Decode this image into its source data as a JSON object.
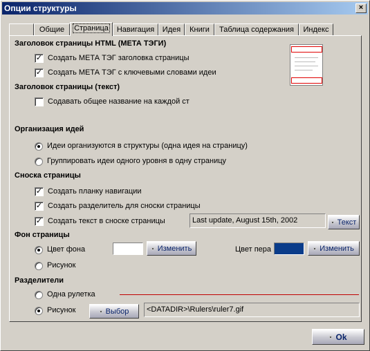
{
  "window": {
    "title": "Опции структуры",
    "close_label": "×"
  },
  "tabs": [
    {
      "label": ""
    },
    {
      "label": "Общие"
    },
    {
      "label": "Страница"
    },
    {
      "label": "Навигация"
    },
    {
      "label": "Идея"
    },
    {
      "label": "Книги"
    },
    {
      "label": "Таблица содержания"
    },
    {
      "label": "Индекс"
    }
  ],
  "sections": {
    "html_title": "Заголовок страницы HTML (МЕТА ТЭГИ)",
    "page_title": "Заголовок страницы (текст)",
    "idea_org": "Организация идей",
    "footnote": "Сноска страницы",
    "background": "Фон страницы",
    "dividers": "Разделители"
  },
  "meta": {
    "create_title_tag": {
      "label": "Создать МЕТА ТЭГ заголовка страницы",
      "checked": true
    },
    "create_keywords_tag": {
      "label": "Создать МЕТА ТЭГ с ключевыми словами идеи",
      "checked": true
    }
  },
  "page_title": {
    "common_name": {
      "label": "Содавать общее название на каждой ст",
      "checked": false
    }
  },
  "idea_org": {
    "one_per_page": {
      "label": "Идеи организуются в структуры (одна идея на страницу)",
      "selected": true
    },
    "group_same_level": {
      "label": "Группировать идеи одного уровня в одну страницу",
      "selected": false
    }
  },
  "footnote": {
    "nav_bar": {
      "label": "Создать планку навигации",
      "checked": true
    },
    "separator": {
      "label": "Создать разделитель для сноски страницы",
      "checked": true
    },
    "text": {
      "label": "Создать текст в сноске страницы",
      "checked": true,
      "value": "Last update, August 15th, 2002"
    },
    "text_button": "Текст"
  },
  "background": {
    "color_option": {
      "label": "Цвет фона",
      "selected": true,
      "swatch_color": "#ffffff"
    },
    "change_button": "Изменить",
    "image_option": {
      "label": "Рисунок",
      "selected": false
    },
    "pen_color_label": "Цвет пера",
    "pen_color": "#0a3c8a",
    "pen_change_button": "Изменить"
  },
  "dividers": {
    "single_ruler": {
      "label": "Одна рулетка",
      "selected": false,
      "line_color": "#c00000"
    },
    "image": {
      "label": "Рисунок",
      "selected": true
    },
    "choose_button": "Выбор",
    "path": "<DATADIR>\\Rulers\\ruler7.gif"
  },
  "footer": {
    "ok_button": "Ok"
  },
  "colors": {
    "title_gradient_start": "#0a246a",
    "title_gradient_end": "#a6caf0",
    "button_text": "#0a246a"
  }
}
